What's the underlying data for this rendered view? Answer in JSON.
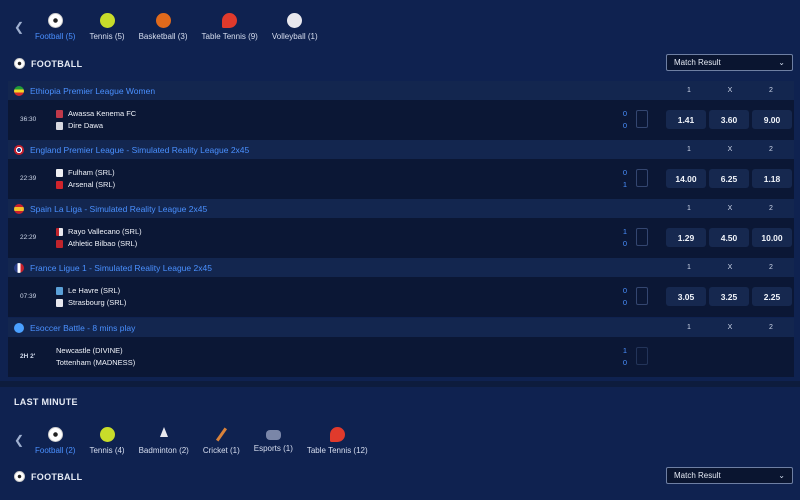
{
  "live": {
    "sport_tabs": [
      {
        "label": "Football (5)",
        "icon": "football-icon",
        "active": true
      },
      {
        "label": "Tennis (5)",
        "icon": "tennis-icon"
      },
      {
        "label": "Basketball (3)",
        "icon": "basketball-icon"
      },
      {
        "label": "Table Tennis (9)",
        "icon": "table-tennis-icon"
      },
      {
        "label": "Volleyball (1)",
        "icon": "volleyball-icon"
      }
    ],
    "section_title": "FOOTBALL",
    "market": "Match Result",
    "odds_headers": [
      "1",
      "X",
      "2"
    ],
    "leagues": [
      {
        "name": "Ethiopia Premier League Women",
        "time": "36:30",
        "home": "Awassa Kenema FC",
        "away": "Dire Dawa",
        "home_score": "0",
        "away_score": "0",
        "odds": [
          "1.41",
          "3.60",
          "9.00"
        ]
      },
      {
        "name": "England Premier League - Simulated Reality League 2x45",
        "time": "22:39",
        "home": "Fulham (SRL)",
        "away": "Arsenal (SRL)",
        "home_score": "0",
        "away_score": "1",
        "odds": [
          "14.00",
          "6.25",
          "1.18"
        ]
      },
      {
        "name": "Spain La Liga - Simulated Reality League 2x45",
        "time": "22:29",
        "home": "Rayo Vallecano (SRL)",
        "away": "Athletic Bilbao (SRL)",
        "home_score": "1",
        "away_score": "0",
        "odds": [
          "1.29",
          "4.50",
          "10.00"
        ]
      },
      {
        "name": "France Ligue 1 - Simulated Reality League 2x45",
        "time": "07:39",
        "home": "Le Havre (SRL)",
        "away": "Strasbourg (SRL)",
        "home_score": "0",
        "away_score": "0",
        "odds": [
          "3.05",
          "3.25",
          "2.25"
        ]
      },
      {
        "name": "Esoccer Battle - 8 mins play",
        "time": "2H 2'",
        "home": "Newcastle (DIVINE)",
        "away": "Tottenham (MADNESS)",
        "home_score": "1",
        "away_score": "0",
        "odds": []
      }
    ]
  },
  "last_minute": {
    "title": "LAST MINUTE",
    "sport_tabs": [
      {
        "label": "Football (2)",
        "icon": "football-icon",
        "active": true
      },
      {
        "label": "Tennis (4)",
        "icon": "tennis-icon"
      },
      {
        "label": "Badminton (2)",
        "icon": "badminton-icon"
      },
      {
        "label": "Cricket (1)",
        "icon": "cricket-icon"
      },
      {
        "label": "Esports (1)",
        "icon": "esports-icon"
      },
      {
        "label": "Table Tennis (12)",
        "icon": "table-tennis-icon"
      }
    ],
    "section_title": "FOOTBALL",
    "market": "Match Result"
  },
  "colors": {
    "accent": "#4a90ff",
    "panel": "#0f2250",
    "league_bar": "#13264f",
    "odd_button": "#16284f"
  }
}
